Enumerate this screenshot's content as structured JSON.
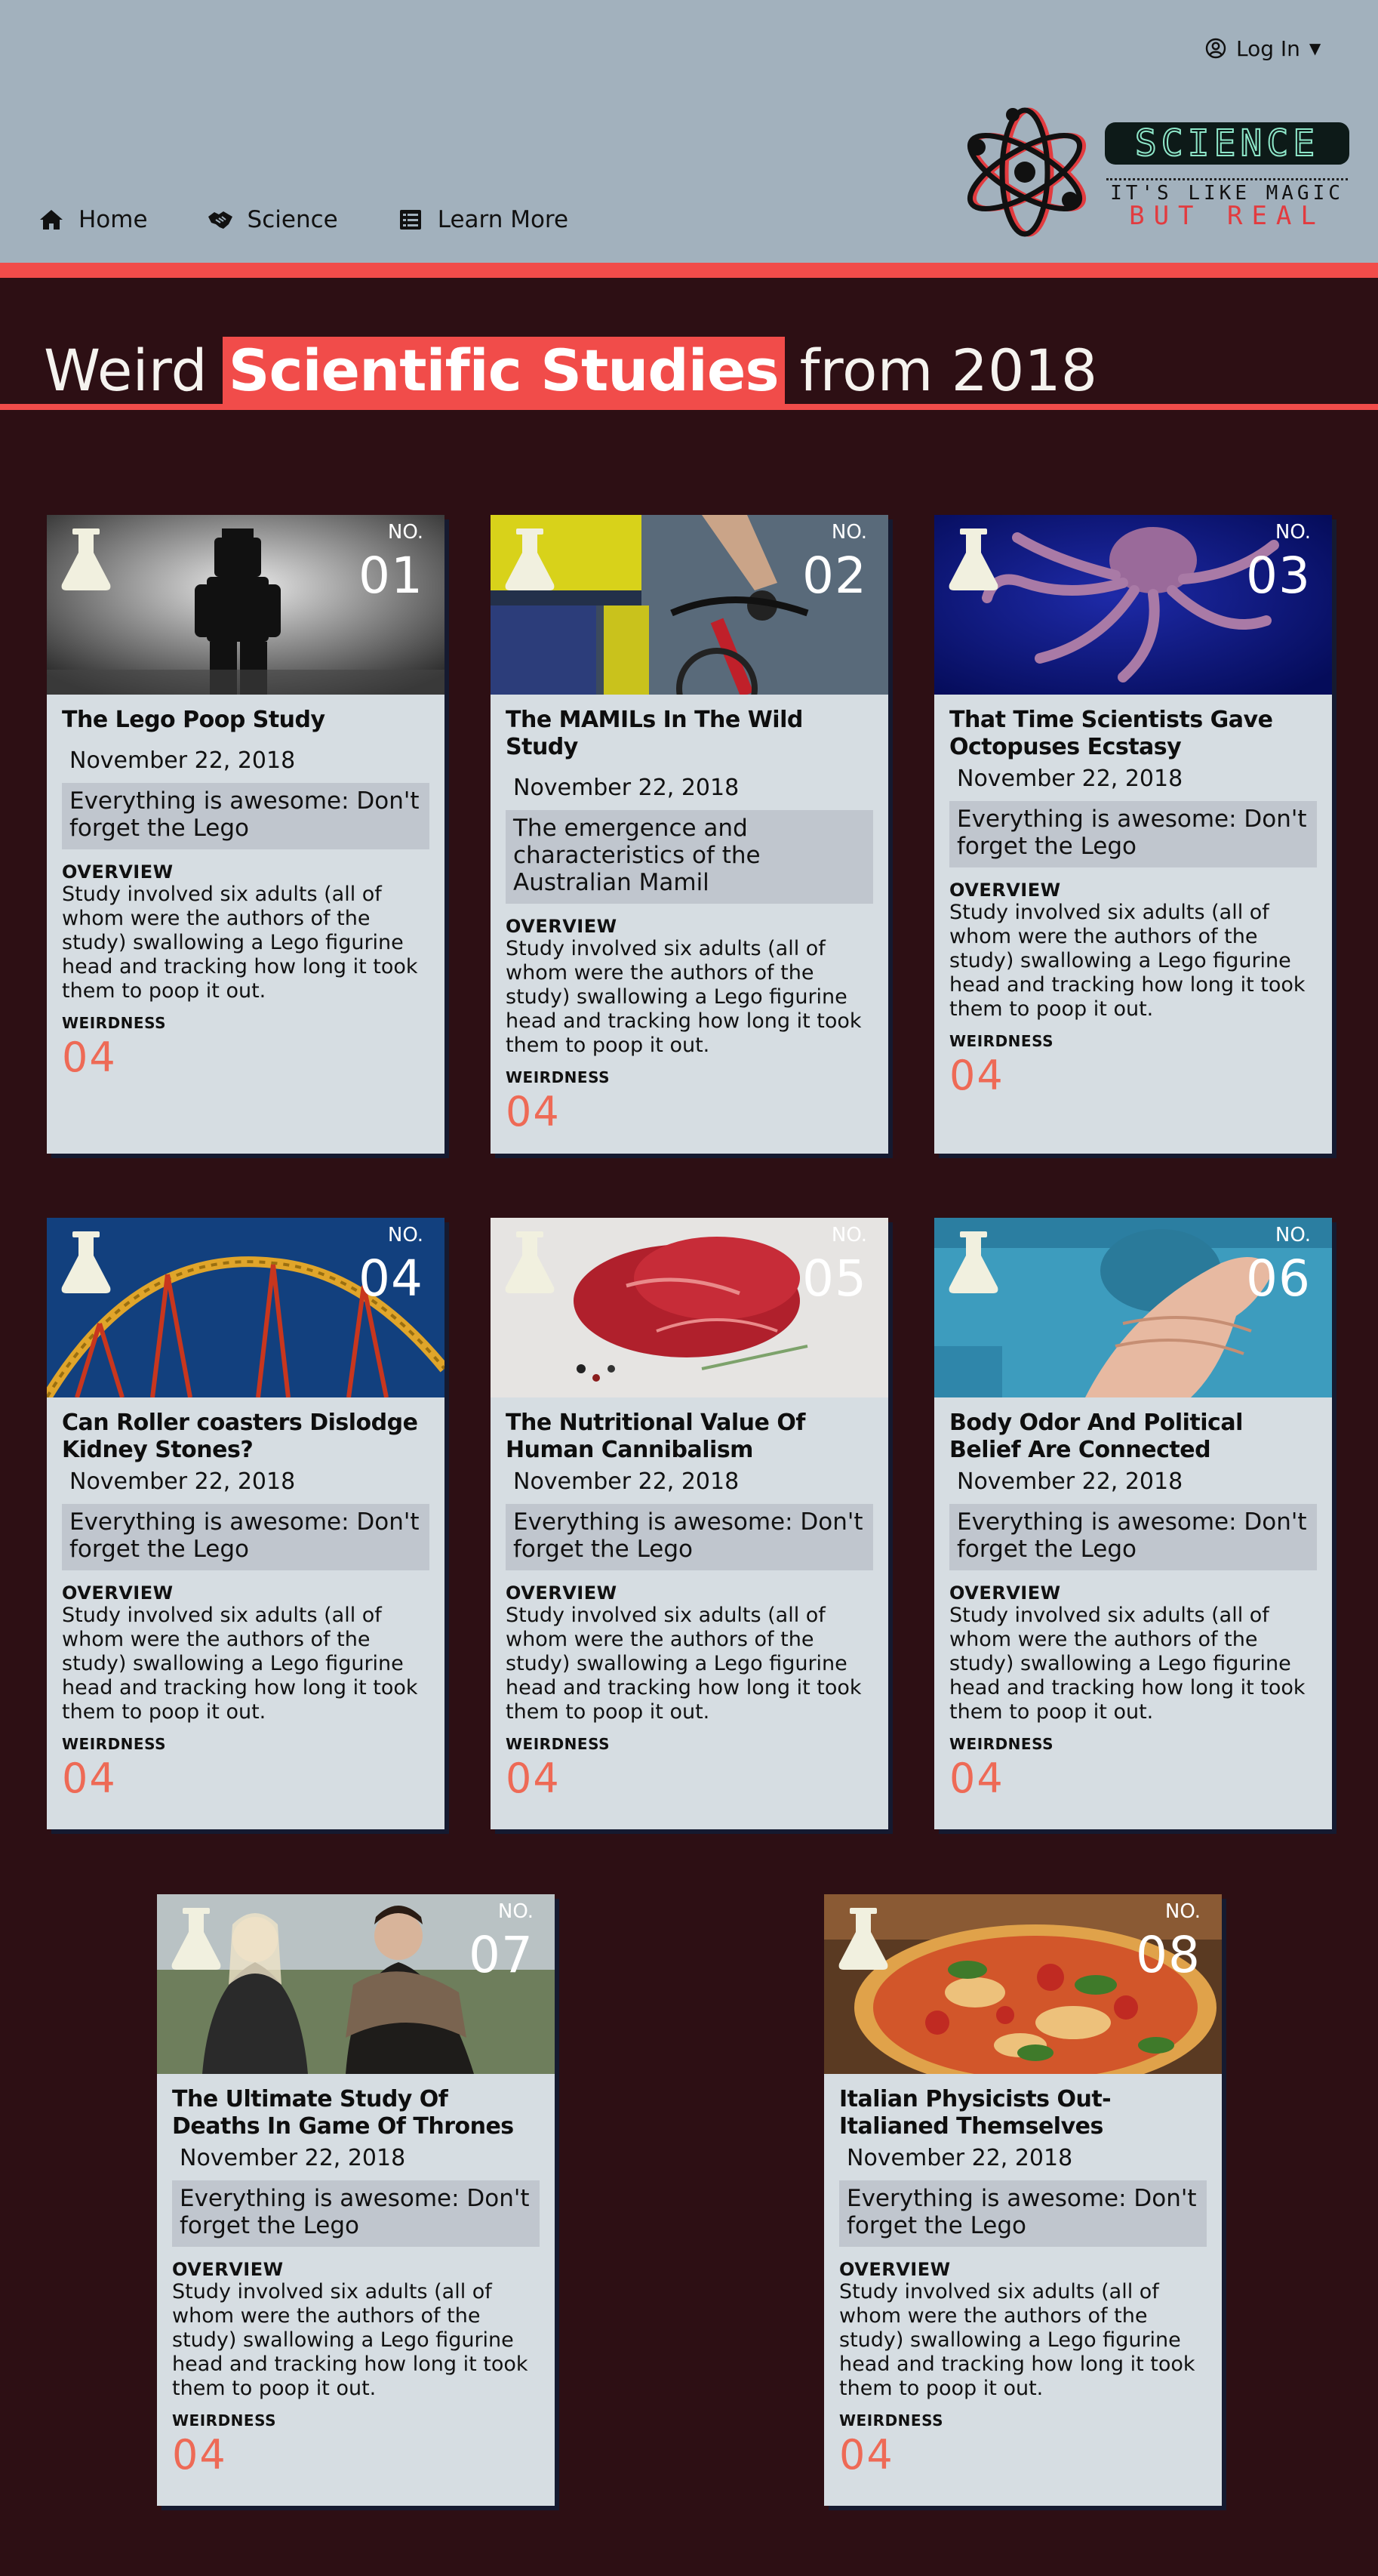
{
  "header": {
    "login_label": "Log In",
    "nav": [
      {
        "label": "Home",
        "icon": "home-icon"
      },
      {
        "label": "Science",
        "icon": "handshake-icon"
      },
      {
        "label": "Learn More",
        "icon": "list-icon"
      }
    ],
    "logo": {
      "word": "SCIENCE",
      "tagline": "IT'S LIKE MAGIC",
      "tagline2": "BUT REAL"
    }
  },
  "title": {
    "pre": "Weird",
    "highlight": "Scientific Studies",
    "post": "from 2018"
  },
  "colors": {
    "accent": "#f14c4a",
    "page_bg": "#2d0f14",
    "header_bg": "#a2b1bd",
    "card_bg": "#d6dde2",
    "weirdness": "#ee6a56"
  },
  "cards": [
    {
      "no_label": "NO.",
      "number": "01",
      "title": "The Lego Poop Study",
      "date": "November 22, 2018",
      "subtitle": "Everything is awesome: Don't forget the Lego",
      "overview_label": "OVERVIEW",
      "overview": "Study involved six adults (all of whom were the authors of the study) swallowing a Lego figurine head and tracking how long it took them to poop it out.",
      "weirdness_label": "WEIRDNESS",
      "weirdness": "04",
      "image": "lego-figure-image"
    },
    {
      "no_label": "NO.",
      "number": "02",
      "title": "The MAMILs In The Wild Study",
      "date": "November 22, 2018",
      "subtitle": "The emergence and characteristics of the Australian Mamil",
      "overview_label": "OVERVIEW",
      "overview": "Study involved six adults (all of whom were the authors of the study) swallowing a Lego figurine head and tracking how long it took them to poop it out.",
      "weirdness_label": "WEIRDNESS",
      "weirdness": "04",
      "image": "cyclist-image"
    },
    {
      "no_label": "NO.",
      "number": "03",
      "title": "That Time Scientists Gave Octopuses Ecstasy",
      "date": "November 22, 2018",
      "subtitle": "Everything is awesome: Don't forget the Lego",
      "overview_label": "OVERVIEW",
      "overview": "Study involved six adults (all of whom were the authors of the study) swallowing a Lego figurine head and tracking how long it took them to poop it out.",
      "weirdness_label": "WEIRDNESS",
      "weirdness": "04",
      "image": "octopus-image"
    },
    {
      "no_label": "NO.",
      "number": "04",
      "title": "Can Roller coasters Dislodge Kidney Stones?",
      "date": "November 22, 2018",
      "subtitle": "Everything is awesome: Don't forget the Lego",
      "overview_label": "OVERVIEW",
      "overview": "Study involved six adults (all of whom were the authors of the study) swallowing a Lego figurine head and tracking how long it took them to poop it out.",
      "weirdness_label": "WEIRDNESS",
      "weirdness": "04",
      "image": "roller-coaster-image"
    },
    {
      "no_label": "NO.",
      "number": "05",
      "title": "The Nutritional Value Of Human Cannibalism",
      "date": "November 22, 2018",
      "subtitle": "Everything is awesome: Don't forget the Lego",
      "overview_label": "OVERVIEW",
      "overview": "Study involved six adults (all of whom were the authors of the study) swallowing a Lego figurine head and tracking how long it took them to poop it out.",
      "weirdness_label": "WEIRDNESS",
      "weirdness": "04",
      "image": "raw-meat-image"
    },
    {
      "no_label": "NO.",
      "number": "06",
      "title": "Body Odor And Political Belief Are Connected",
      "date": "November 22, 2018",
      "subtitle": "Everything is awesome: Don't forget the Lego",
      "overview_label": "OVERVIEW",
      "overview": "Study involved six adults (all of whom were the authors of the study) swallowing a Lego figurine head and tracking how long it took them to poop it out.",
      "weirdness_label": "WEIRDNESS",
      "weirdness": "04",
      "image": "sweaty-shirt-image"
    },
    {
      "no_label": "NO.",
      "number": "07",
      "title": "The Ultimate Study Of Deaths In Game Of Thrones",
      "date": "November 22, 2018",
      "subtitle": "Everything is awesome: Don't forget the Lego",
      "overview_label": "OVERVIEW",
      "overview": "Study involved six adults (all of whom were the authors of the study) swallowing a Lego figurine head and tracking how long it took them to poop it out.",
      "weirdness_label": "WEIRDNESS",
      "weirdness": "04",
      "image": "game-of-thrones-image"
    },
    {
      "no_label": "NO.",
      "number": "08",
      "title": "Italian Physicists Out-Italianed Themselves",
      "date": "November 22, 2018",
      "subtitle": "Everything is awesome: Don't forget the Lego",
      "overview_label": "OVERVIEW",
      "overview": "Study involved six adults (all of whom were the authors of the study) swallowing a Lego figurine head and tracking how long it took them to poop it out.",
      "weirdness_label": "WEIRDNESS",
      "weirdness": "04",
      "image": "pizza-image"
    }
  ]
}
